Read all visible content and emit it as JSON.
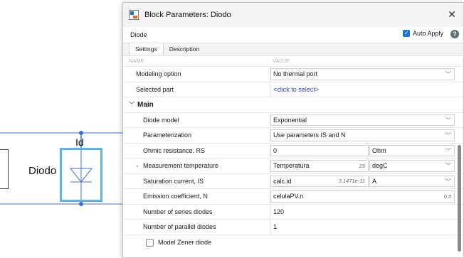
{
  "canvas": {
    "block_name": "Diodo",
    "port_label": "Id"
  },
  "dialog": {
    "title": "Block Parameters: Diodo",
    "block_name": "Diode",
    "auto_apply_label": "Auto Apply",
    "auto_apply_checked": true,
    "tabs": [
      {
        "label": "Settings",
        "active": true
      },
      {
        "label": "Description",
        "active": false
      }
    ],
    "col_name": "NAME",
    "col_value": "VALUE",
    "modeling_option": {
      "label": "Modeling option",
      "value": "No thermal port"
    },
    "selected_part": {
      "label": "Selected part",
      "value": "<click to select>"
    },
    "section_main": "Main",
    "params": {
      "diode_model": {
        "label": "Diode model",
        "value": "Exponential"
      },
      "parameterization": {
        "label": "Parameterization",
        "value": "Use parameters IS and N"
      },
      "ohmic_resistance": {
        "label": "Ohmic resistance, RS",
        "value": "0",
        "unit": "Ohm"
      },
      "measurement_temperature": {
        "label": "Measurement temperature",
        "value": "Temperatura",
        "shown": "25",
        "unit": "degC"
      },
      "saturation_current": {
        "label": "Saturation current, IS",
        "value": "calc.id",
        "shown": "3.1471e-11",
        "unit": "A"
      },
      "emission_coefficient": {
        "label": "Emission coefficient, N",
        "value": "celulaPV.n",
        "shown": "0.5"
      },
      "series_diodes": {
        "label": "Number of series diodes",
        "value": "120"
      },
      "parallel_diodes": {
        "label": "Number of parallel diodes",
        "value": "1"
      },
      "zener": {
        "label": "Model Zener diode",
        "checked": false
      }
    }
  },
  "colors": {
    "accent": "#1a73d2",
    "block_border": "#5ab4e8",
    "link": "#2b45d8"
  }
}
